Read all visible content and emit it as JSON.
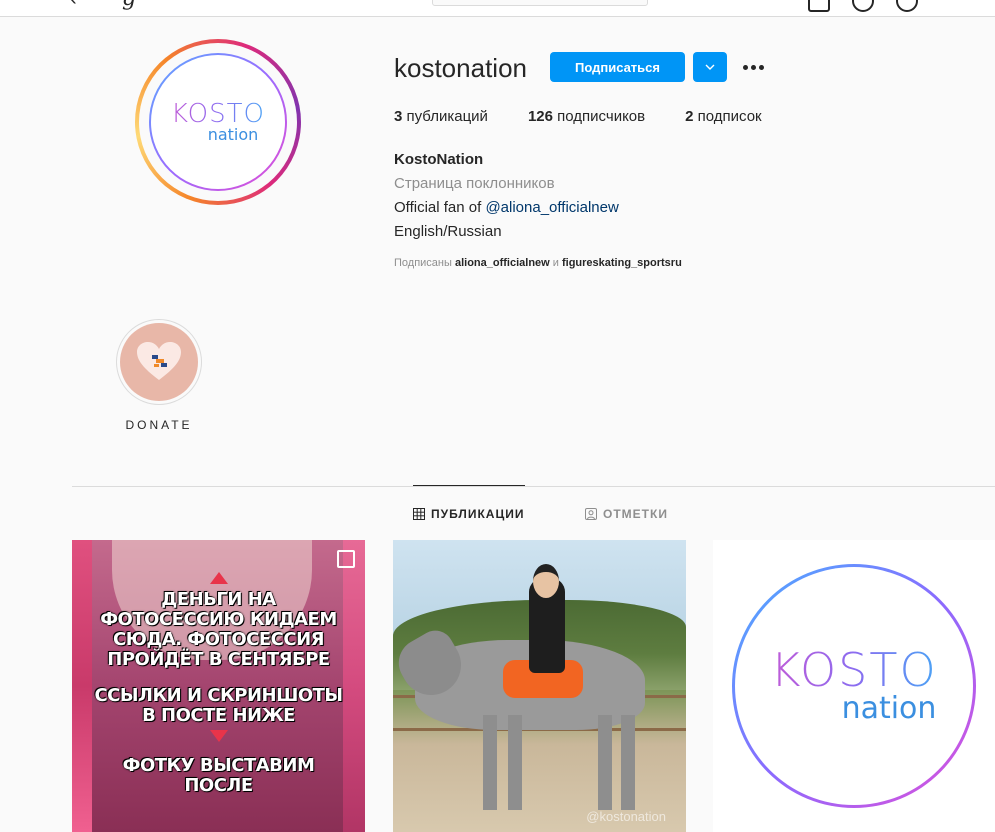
{
  "profile": {
    "username": "kostonation",
    "follow_label": "Подписаться",
    "full_name": "KostoNation",
    "category": "Страница поклонников",
    "bio_line_prefix": "Official fan of ",
    "bio_mention": "@aliona_officialnew",
    "bio_language": "English/Russian",
    "avatar_logo": {
      "top": "KOSTO",
      "bottom": "nation"
    },
    "stats": {
      "posts_count": "3",
      "posts_label": "публикаций",
      "followers_count": "126",
      "followers_label": "подписчиков",
      "following_count": "2",
      "following_label": "подписок"
    },
    "followed_by": {
      "prefix": "Подписаны ",
      "user1": "aliona_officialnew",
      "conjunction": " и ",
      "user2": "figureskating_sportsru"
    }
  },
  "highlights": [
    {
      "label": "DONATE"
    }
  ],
  "tabs": [
    {
      "label": "ПУБЛИКАЦИИ",
      "icon": "grid-icon",
      "active": true
    },
    {
      "label": "ОТМЕТКИ",
      "icon": "tagged-user-icon",
      "active": false
    }
  ],
  "posts": [
    {
      "type": "carousel",
      "text_lines": [
        "ДЕНЬГИ НА ФОТОСЕССИЮ КИДАЕМ СЮДА. ФОТОСЕССИЯ ПРОЙДЁТ В СЕНТЯБРЕ",
        "ССЫЛКИ И СКРИНШОТЫ В ПОСТЕ НИЖЕ",
        "ФОТКУ ВЫСТАВИМ ПОСЛЕ"
      ]
    },
    {
      "type": "photo",
      "watermark": "@kostonation"
    },
    {
      "type": "photo",
      "logo": {
        "top": "KOSTO",
        "bottom": "nation"
      }
    }
  ],
  "colors": {
    "accent": "#0095f6",
    "link": "#00376b",
    "muted": "#8e8e8e",
    "text": "#262626"
  }
}
